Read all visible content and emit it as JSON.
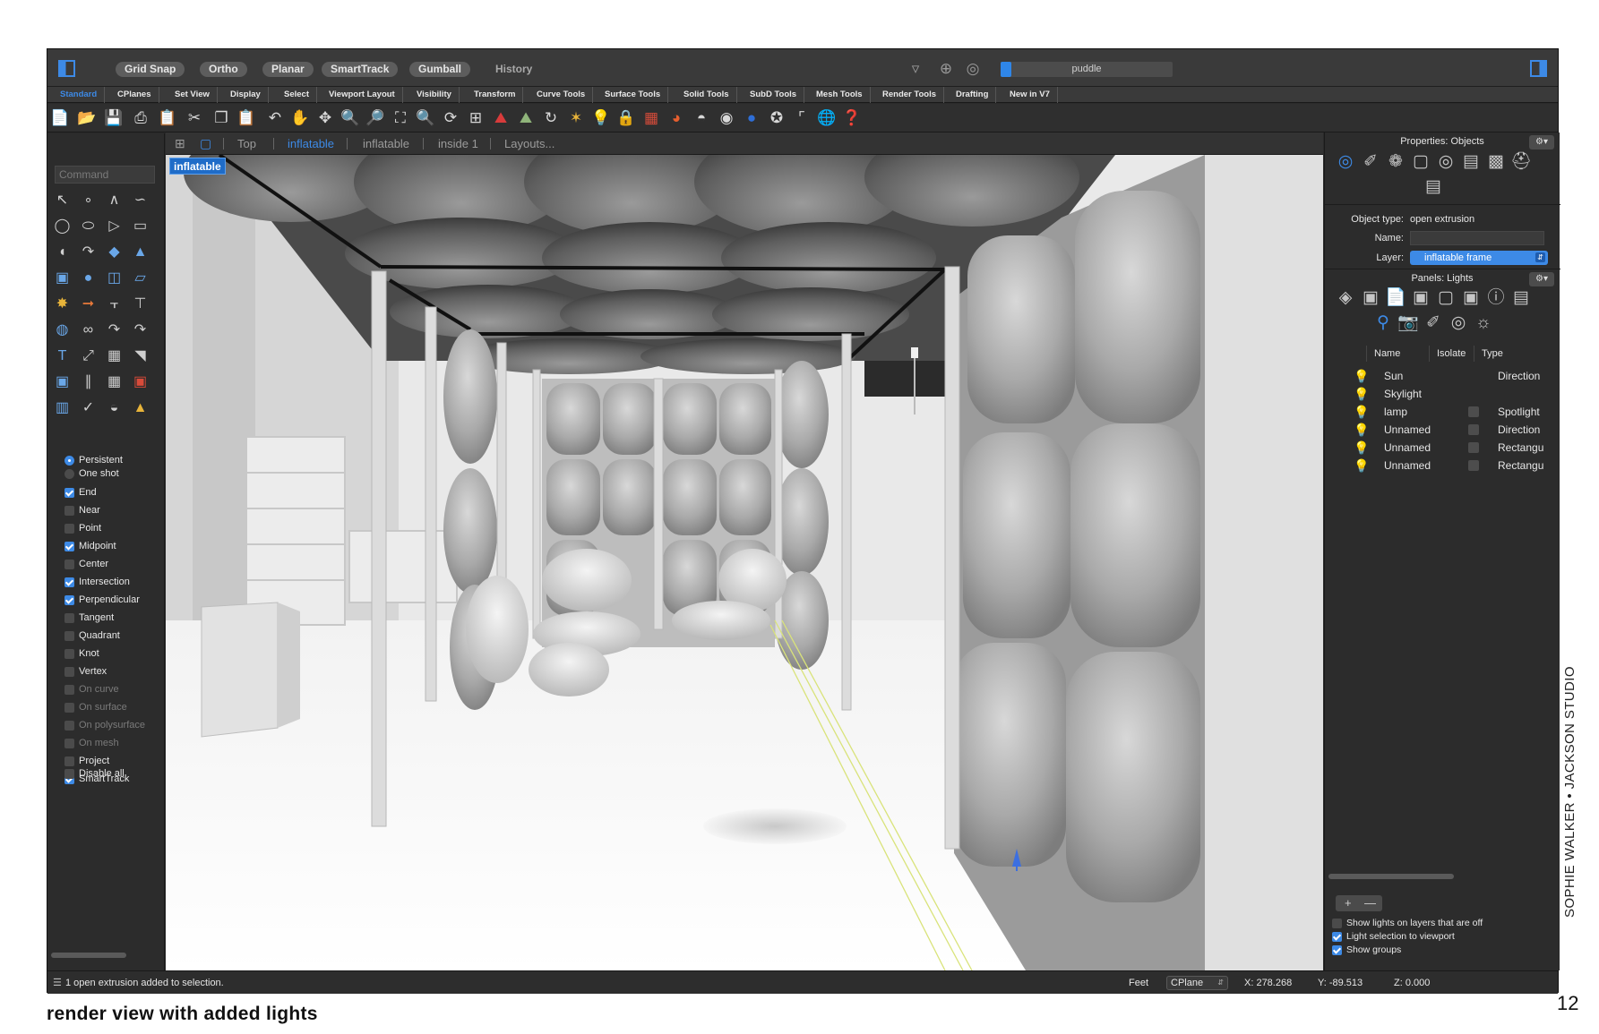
{
  "topbar": {
    "pills": [
      "Grid Snap",
      "Ortho",
      "Planar",
      "SmartTrack",
      "Gumball"
    ],
    "history_label": "History",
    "progress_label": "puddle",
    "progress_fraction": 0.06
  },
  "tabs": [
    "Standard",
    "CPlanes",
    "Set View",
    "Display",
    "Select",
    "Viewport Layout",
    "Visibility",
    "Transform",
    "Curve Tools",
    "Surface Tools",
    "Solid Tools",
    "SubD Tools",
    "Mesh Tools",
    "Render Tools",
    "Drafting",
    "New in V7"
  ],
  "active_tab": "Standard",
  "command": {
    "placeholder": "Command"
  },
  "viewport_tabs": [
    "Top",
    "inflatable",
    "inflatable",
    "inside 1",
    "Layouts..."
  ],
  "viewport_label": "inflatable",
  "osnaps": {
    "radio": [
      {
        "label": "Persistent",
        "on": true
      },
      {
        "label": "One shot",
        "on": false
      }
    ],
    "items": [
      {
        "label": "End",
        "on": true,
        "enabled": true
      },
      {
        "label": "Near",
        "on": false,
        "enabled": true
      },
      {
        "label": "Point",
        "on": false,
        "enabled": true
      },
      {
        "label": "Midpoint",
        "on": true,
        "enabled": true
      },
      {
        "label": "Center",
        "on": false,
        "enabled": true
      },
      {
        "label": "Intersection",
        "on": true,
        "enabled": true
      },
      {
        "label": "Perpendicular",
        "on": true,
        "enabled": true
      },
      {
        "label": "Tangent",
        "on": false,
        "enabled": true
      },
      {
        "label": "Quadrant",
        "on": false,
        "enabled": true
      },
      {
        "label": "Knot",
        "on": false,
        "enabled": true
      },
      {
        "label": "Vertex",
        "on": false,
        "enabled": true
      },
      {
        "label": "On curve",
        "on": false,
        "enabled": false
      },
      {
        "label": "On surface",
        "on": false,
        "enabled": false
      },
      {
        "label": "On polysurface",
        "on": false,
        "enabled": false
      },
      {
        "label": "On mesh",
        "on": false,
        "enabled": false
      },
      {
        "label": "Project",
        "on": false,
        "enabled": true
      },
      {
        "label": "SmartTrack",
        "on": true,
        "enabled": true
      }
    ],
    "disable_all": "Disable all"
  },
  "properties": {
    "title": "Properties: Objects",
    "object_type_label": "Object type:",
    "object_type_value": "open extrusion",
    "name_label": "Name:",
    "name_value": "",
    "layer_label": "Layer:",
    "layer_value": "inflatable frame"
  },
  "lights": {
    "title": "Panels: Lights",
    "columns": [
      "Name",
      "Isolate",
      "Type"
    ],
    "rows": [
      {
        "name": "Sun",
        "type": "Direction",
        "isolate": false,
        "color": "#f2d13b"
      },
      {
        "name": "Skylight",
        "type": "",
        "isolate": false,
        "color": "#6aa7e8"
      },
      {
        "name": "lamp",
        "type": "Spotlight",
        "isolate": true,
        "color": "#f2d13b"
      },
      {
        "name": "Unnamed",
        "type": "Direction",
        "isolate": true,
        "color": "#f2d13b"
      },
      {
        "name": "Unnamed",
        "type": "Rectangu",
        "isolate": true,
        "color": "#f2d13b"
      },
      {
        "name": "Unnamed",
        "type": "Rectangu",
        "isolate": true,
        "color": "#f2d13b"
      }
    ],
    "options": [
      {
        "label": "Show lights on layers that are off",
        "on": false
      },
      {
        "label": "Light selection to viewport",
        "on": true
      },
      {
        "label": "Show groups",
        "on": true
      }
    ]
  },
  "status": {
    "message": "1 open extrusion added to selection.",
    "units": "Feet",
    "cplane": "CPlane",
    "x": "X: 278.268",
    "y": "Y: -89.513",
    "z": "Z: 0.000"
  },
  "page": {
    "caption": "render view with added lights",
    "studio": "SOPHIE WALKER • JACKSON STUDIO",
    "number": "12"
  },
  "colors": {
    "accent": "#3d8ae6",
    "panel_bg": "#2c2c2c",
    "viewport_bg": "#e6e6e6"
  }
}
